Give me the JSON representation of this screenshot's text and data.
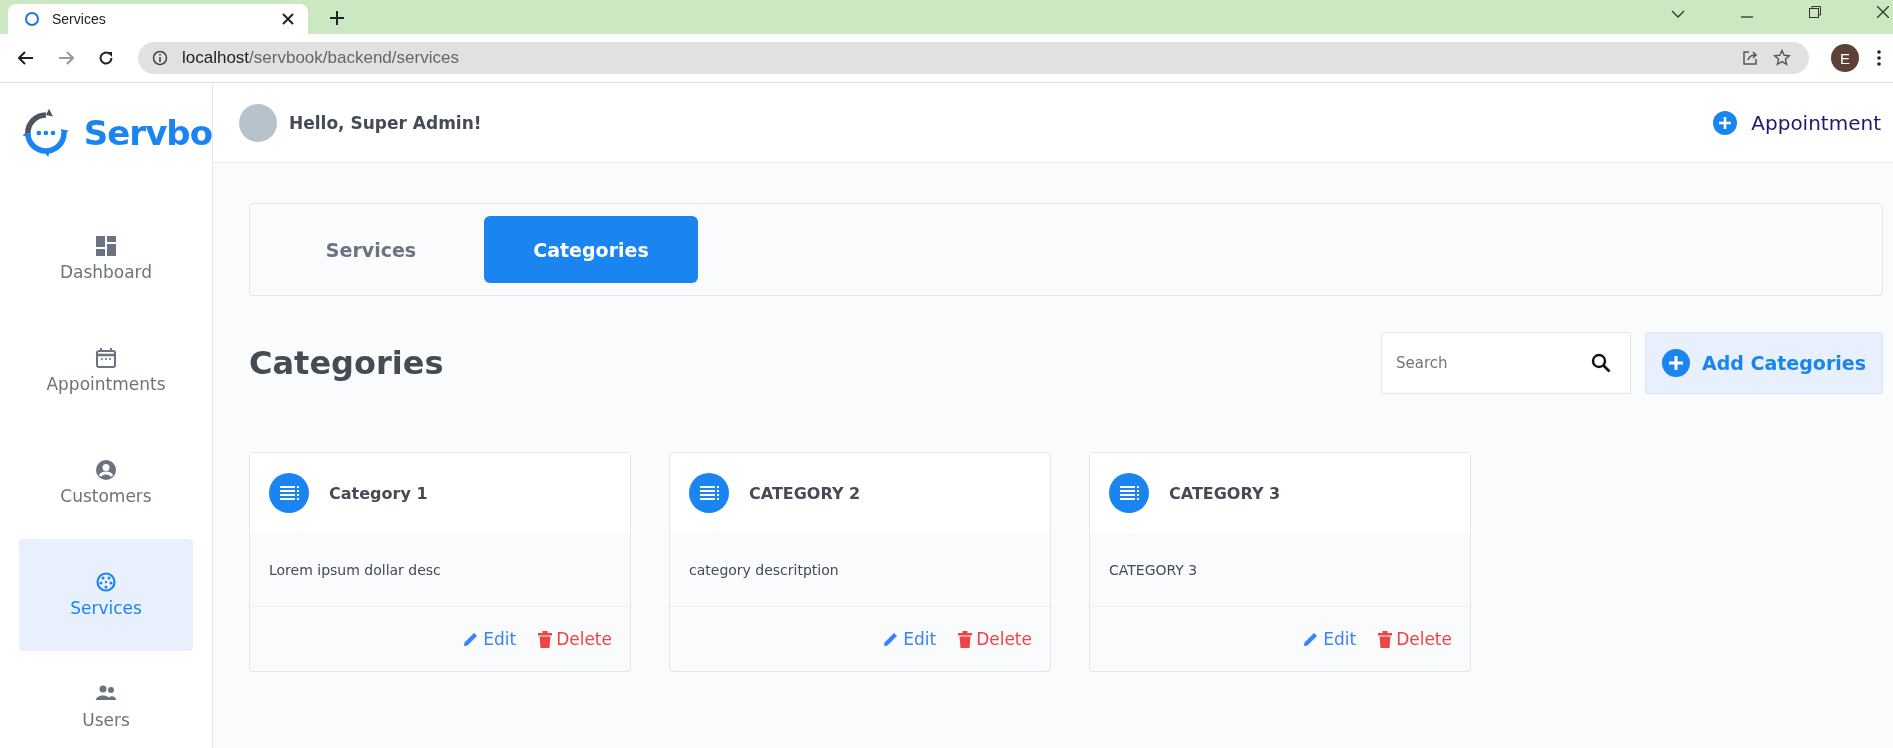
{
  "browser": {
    "tab_title": "Services",
    "url_host": "localhost",
    "url_path": "/servbook/backend/services",
    "profile_initial": "E"
  },
  "sidebar": {
    "logo_text": "Servbo",
    "items": [
      {
        "label": "Dashboard",
        "kind": "dashboard",
        "selected": false
      },
      {
        "label": "Appointments",
        "kind": "calendar",
        "selected": false
      },
      {
        "label": "Customers",
        "kind": "person",
        "selected": false
      },
      {
        "label": "Services",
        "kind": "services",
        "selected": true
      },
      {
        "label": "Users",
        "kind": "group",
        "selected": false
      }
    ]
  },
  "header": {
    "greeting": "Hello, Super Admin!",
    "action": "Appointment"
  },
  "tabs": [
    {
      "label": "Services",
      "selected": false
    },
    {
      "label": "Categories",
      "selected": true
    }
  ],
  "page": {
    "title": "Categories",
    "search_placeholder": "Search",
    "add_button": "Add Categories"
  },
  "cards": [
    {
      "title": "Category 1",
      "description": "Lorem ipsum dollar desc",
      "edit": "Edit",
      "delete": "Delete"
    },
    {
      "title": "CATEGORY 2",
      "description": "category descritption",
      "edit": "Edit",
      "delete": "Delete"
    },
    {
      "title": "CATEGORY 3",
      "description": "CATEGORY 3",
      "edit": "Edit",
      "delete": "Delete"
    }
  ]
}
